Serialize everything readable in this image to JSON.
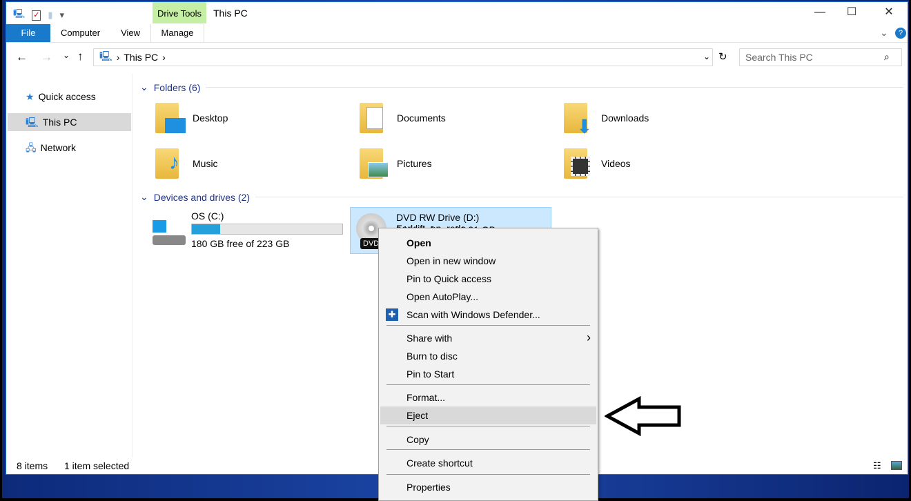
{
  "window": {
    "title": "This PC",
    "context_tab": "Drive Tools",
    "controls": [
      "minimize-icon",
      "maximize-icon",
      "close-icon"
    ]
  },
  "ribbon": {
    "tabs": [
      "File",
      "Computer",
      "View",
      "Manage"
    ]
  },
  "nav": {
    "breadcrumb": [
      "This PC"
    ],
    "search_placeholder": "Search This PC"
  },
  "sidebar": {
    "items": [
      {
        "label": "Quick access",
        "icon": "star-icon"
      },
      {
        "label": "This PC",
        "icon": "computer-icon",
        "selected": true
      },
      {
        "label": "Network",
        "icon": "network-icon"
      }
    ]
  },
  "folders": {
    "header": "Folders (6)",
    "items": [
      "Desktop",
      "Documents",
      "Downloads",
      "Music",
      "Pictures",
      "Videos"
    ]
  },
  "drives": {
    "header": "Devices and drives (2)",
    "c": {
      "name": "OS (C:)",
      "free": "180 GB free of 223 GB",
      "used_percent": 19
    },
    "d": {
      "name": "DVD RW Drive (D:) Forklift_en_redo",
      "free": "0 bytes free of 1.21 GB",
      "badge": "DVD"
    }
  },
  "context_menu": {
    "items": [
      "Open",
      "Open in new window",
      "Pin to Quick access",
      "Open AutoPlay...",
      "Scan with Windows Defender...",
      "Share with",
      "Burn to disc",
      "Pin to Start",
      "Format...",
      "Eject",
      "Copy",
      "Create shortcut",
      "Properties"
    ],
    "highlighted": "Eject"
  },
  "status": {
    "count": "8 items",
    "selected": "1 item selected"
  },
  "colors": {
    "accent": "#1979ca",
    "selection": "#cce8ff",
    "context_tab": "#c6efa6"
  }
}
